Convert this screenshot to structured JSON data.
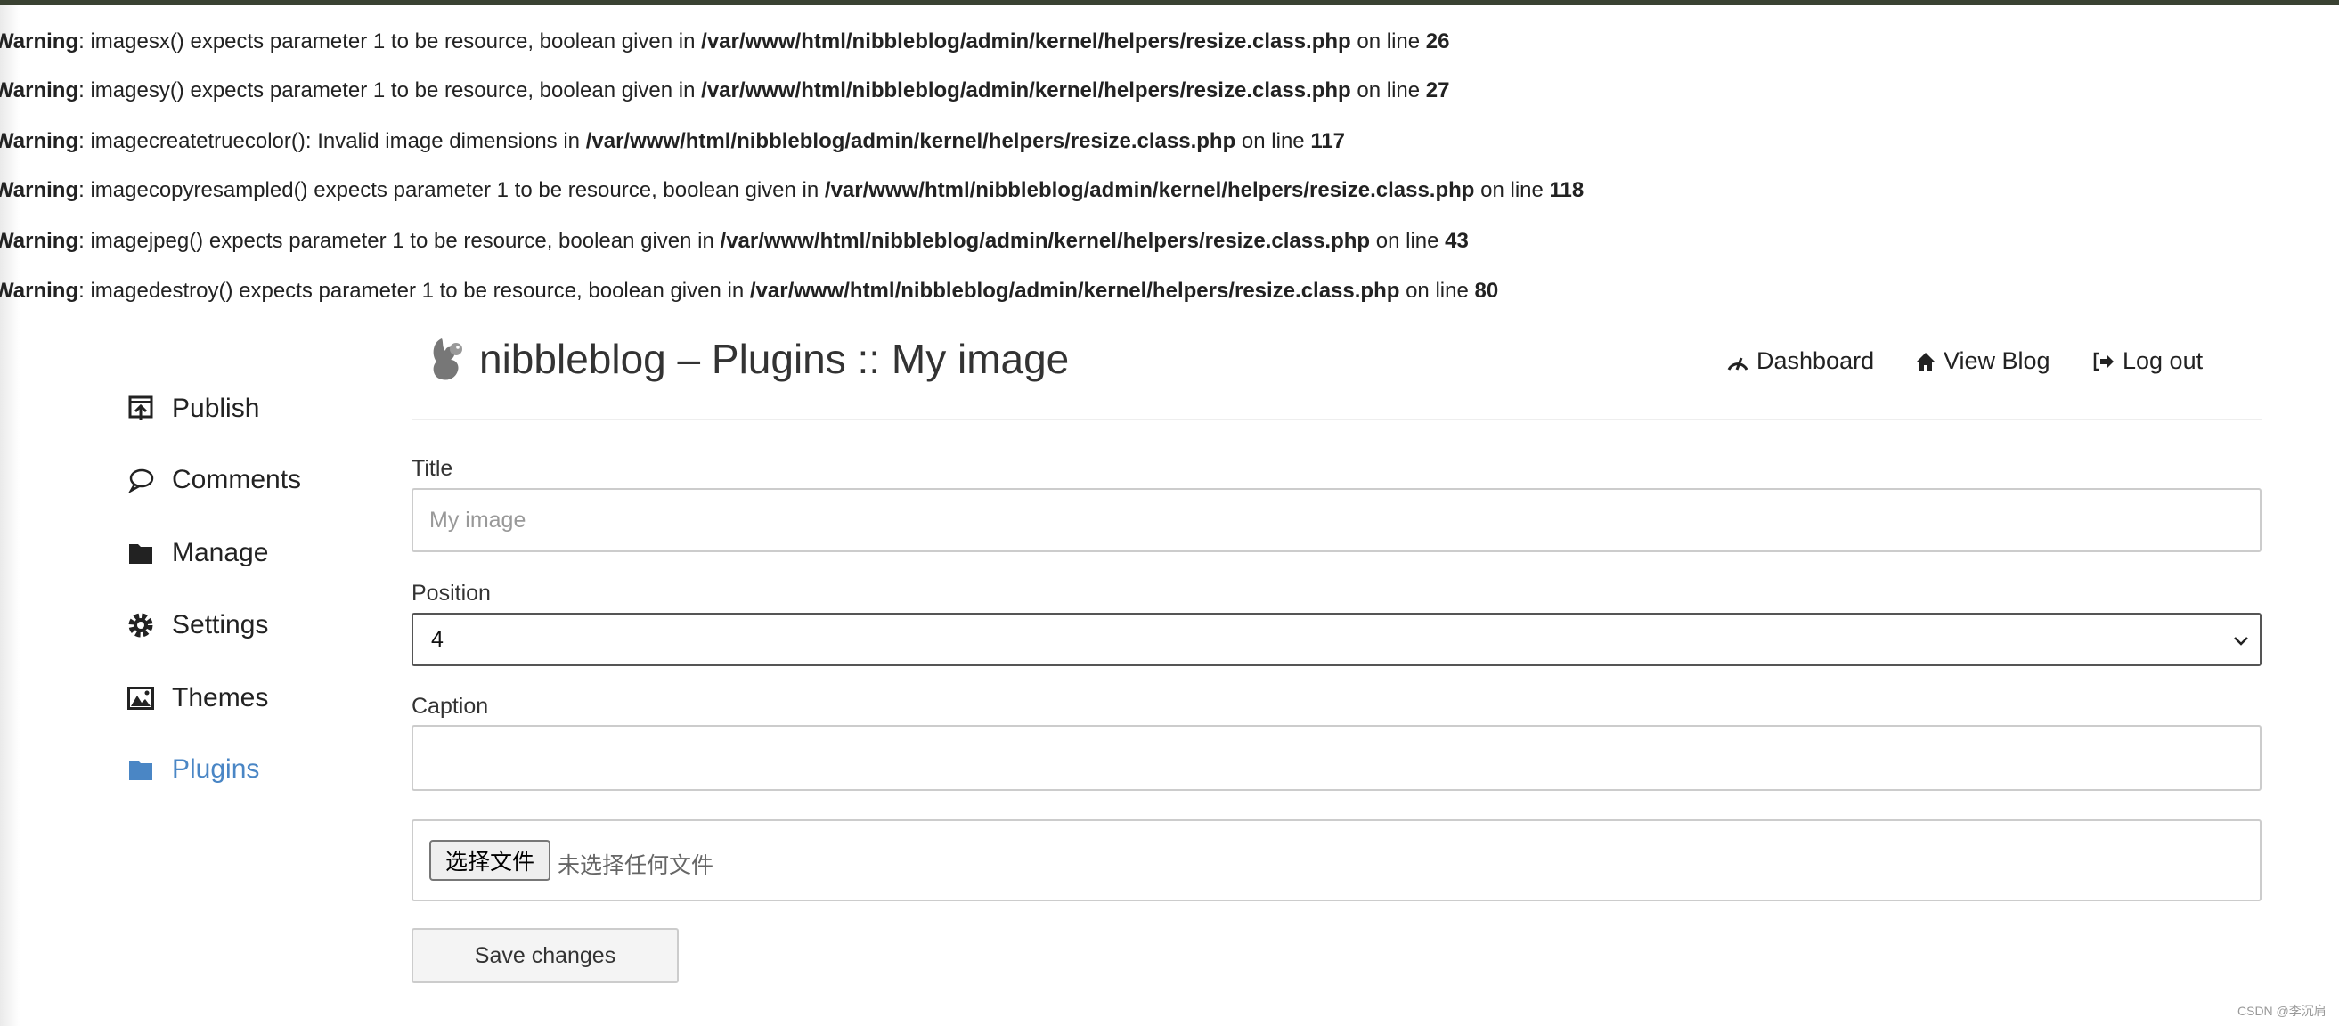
{
  "warnings": [
    {
      "label": "Warning",
      "msg": ": imagesx() expects parameter 1 to be resource, boolean given in ",
      "file": "/var/www/html/nibbleblog/admin/kernel/helpers/resize.class.php",
      "online": " on line ",
      "line": "26"
    },
    {
      "label": "Warning",
      "msg": ": imagesy() expects parameter 1 to be resource, boolean given in ",
      "file": "/var/www/html/nibbleblog/admin/kernel/helpers/resize.class.php",
      "online": " on line ",
      "line": "27"
    },
    {
      "label": "Warning",
      "msg": ": imagecreatetruecolor(): Invalid image dimensions in ",
      "file": "/var/www/html/nibbleblog/admin/kernel/helpers/resize.class.php",
      "online": " on line ",
      "line": "117"
    },
    {
      "label": "Warning",
      "msg": ": imagecopyresampled() expects parameter 1 to be resource, boolean given in ",
      "file": "/var/www/html/nibbleblog/admin/kernel/helpers/resize.class.php",
      "online": " on line ",
      "line": "118"
    },
    {
      "label": "Warning",
      "msg": ": imagejpeg() expects parameter 1 to be resource, boolean given in ",
      "file": "/var/www/html/nibbleblog/admin/kernel/helpers/resize.class.php",
      "online": " on line ",
      "line": "43"
    },
    {
      "label": "Warning",
      "msg": ": imagedestroy() expects parameter 1 to be resource, boolean given in ",
      "file": "/var/www/html/nibbleblog/admin/kernel/helpers/resize.class.php",
      "online": " on line ",
      "line": "80"
    }
  ],
  "header": {
    "title": "nibbleblog – Plugins :: My image",
    "nav": [
      {
        "label": "Dashboard",
        "icon": "dashboard-icon"
      },
      {
        "label": "View Blog",
        "icon": "home-icon"
      },
      {
        "label": "Log out",
        "icon": "logout-icon"
      }
    ]
  },
  "sidebar": {
    "items": [
      {
        "label": "Publish",
        "icon": "publish-icon"
      },
      {
        "label": "Comments",
        "icon": "comment-icon"
      },
      {
        "label": "Manage",
        "icon": "folder-icon"
      },
      {
        "label": "Settings",
        "icon": "gear-icon"
      },
      {
        "label": "Themes",
        "icon": "image-icon"
      },
      {
        "label": "Plugins",
        "icon": "folder-icon",
        "active": true
      }
    ]
  },
  "form": {
    "title_label": "Title",
    "title_placeholder": "My image",
    "position_label": "Position",
    "position_value": "4",
    "caption_label": "Caption",
    "caption_value": "",
    "file_button": "选择文件",
    "file_status": "未选择任何文件",
    "save_label": "Save changes"
  },
  "colors": {
    "accent": "#4a86c5",
    "topbar": "#3a4232"
  },
  "watermark": "CSDN @李沉肩"
}
